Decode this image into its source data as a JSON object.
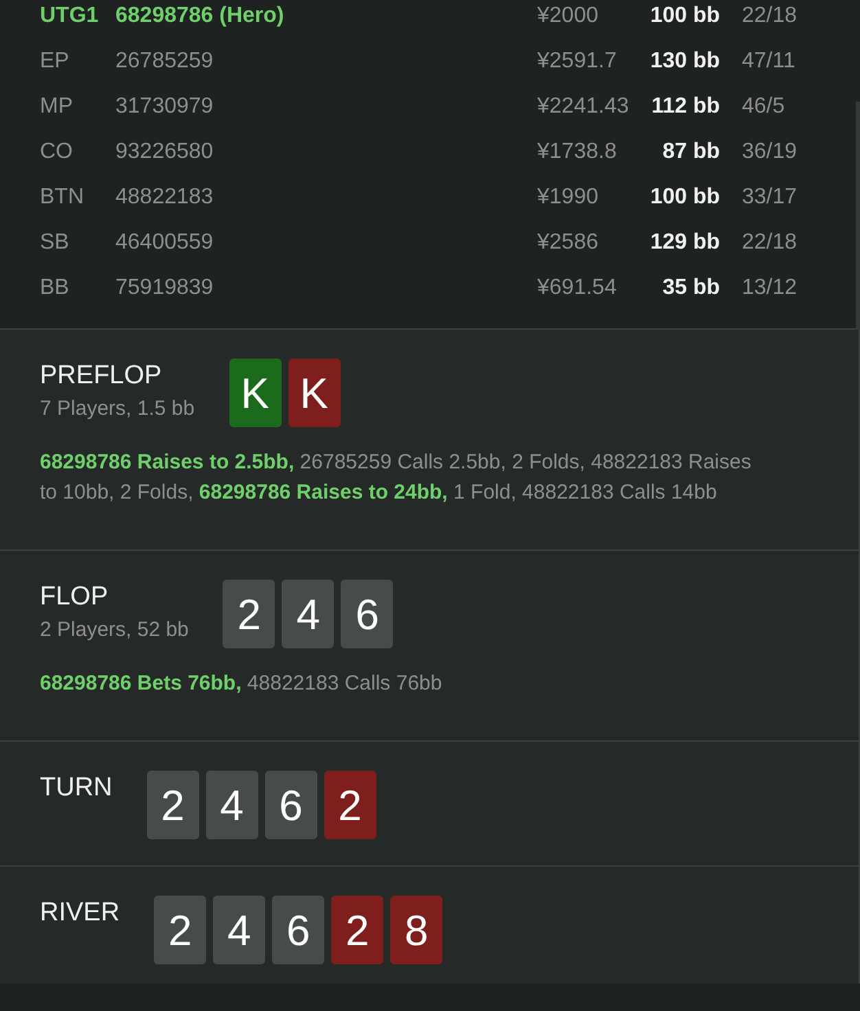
{
  "players": [
    {
      "position": "UTG1",
      "id": "68298786 (Hero)",
      "stack": "¥2000",
      "bb": "100 bb",
      "stats": "22/18",
      "hero": true
    },
    {
      "position": "EP",
      "id": "26785259",
      "stack": "¥2591.7",
      "bb": "130 bb",
      "stats": "47/11",
      "hero": false
    },
    {
      "position": "MP",
      "id": "31730979",
      "stack": "¥2241.43",
      "bb": "112 bb",
      "stats": "46/5",
      "hero": false
    },
    {
      "position": "CO",
      "id": "93226580",
      "stack": "¥1738.8",
      "bb": "87 bb",
      "stats": "36/19",
      "hero": false
    },
    {
      "position": "BTN",
      "id": "48822183",
      "stack": "¥1990",
      "bb": "100 bb",
      "stats": "33/17",
      "hero": false
    },
    {
      "position": "SB",
      "id": "46400559",
      "stack": "¥2586",
      "bb": "129 bb",
      "stats": "22/18",
      "hero": false
    },
    {
      "position": "BB",
      "id": "75919839",
      "stack": "¥691.54",
      "bb": "35 bb",
      "stats": "13/12",
      "hero": false
    }
  ],
  "streets": [
    {
      "title": "PREFLOP",
      "subtitle": "7 Players, 1.5 bb",
      "cards": [
        {
          "rank": "K",
          "color": "#1c6b1c"
        },
        {
          "rank": "K",
          "color": "#7e1f1d"
        }
      ],
      "actions": "**68298786 Raises to 2.5bb,** 26785259 Calls 2.5bb, 2 Folds, 48822183 Raises to 10bb, 2 Folds, **68298786 Raises to 24bb,** 1 Fold, 48822183 Calls 14bb"
    },
    {
      "title": "FLOP",
      "subtitle": "2 Players, 52 bb",
      "cards": [
        {
          "rank": "2",
          "color": "#484b4b"
        },
        {
          "rank": "4",
          "color": "#484b4b"
        },
        {
          "rank": "6",
          "color": "#484b4b"
        }
      ],
      "actions": "**68298786 Bets 76bb,** 48822183 Calls 76bb"
    },
    {
      "title": "TURN",
      "cards": [
        {
          "rank": "2",
          "color": "#484b4b"
        },
        {
          "rank": "4",
          "color": "#484b4b"
        },
        {
          "rank": "6",
          "color": "#484b4b"
        },
        {
          "rank": "2",
          "color": "#7e1f1d"
        }
      ]
    },
    {
      "title": "RIVER",
      "cards": [
        {
          "rank": "2",
          "color": "#484b4b"
        },
        {
          "rank": "4",
          "color": "#484b4b"
        },
        {
          "rank": "6",
          "color": "#484b4b"
        },
        {
          "rank": "2",
          "color": "#7e1f1d"
        },
        {
          "rank": "8",
          "color": "#7e1f1d"
        }
      ]
    }
  ]
}
